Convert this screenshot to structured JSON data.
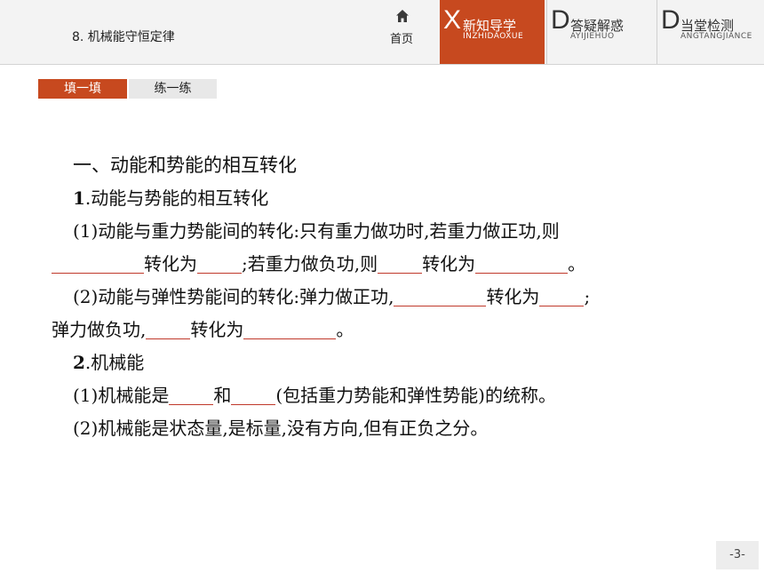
{
  "header": {
    "chapter_title": "8. 机械能守恒定律",
    "home_label": "首页",
    "nav": [
      {
        "letter": "X",
        "label": "新知导学",
        "sub": "INZHIDAOXUE",
        "active": true
      },
      {
        "letter": "D",
        "label": "答疑解惑",
        "sub": "AYIJIEHUO",
        "active": false
      },
      {
        "letter": "D",
        "label": "当堂检测",
        "sub": "ANGTANGJIANCE",
        "active": false
      }
    ]
  },
  "subtabs": [
    "填一填",
    "练一练"
  ],
  "content": {
    "heading": "一、动能和势能的相互转化",
    "s1_num": "1",
    "s1_title": ".动能与势能的相互转化",
    "p1_a": "(1)动能与重力势能间的转化:只有重力做功时,若重力做正功,则",
    "p1_b": "转化为",
    "p1_c": ";若重力做负功,则",
    "p1_d": "转化为",
    "p1_e": "。",
    "p2_a": "(2)动能与弹性势能间的转化:弹力做正功,",
    "p2_b": "转化为",
    "p2_c": ";",
    "p3_a": "弹力做负功,",
    "p3_b": "转化为",
    "p3_c": "。",
    "s2_num": "2",
    "s2_title": ".机械能",
    "p4_a": "(1)机械能是",
    "p4_b": "和",
    "p4_c": "(包括重力势能和弹性势能)的统称。",
    "p5": "(2)机械能是状态量,是标量,没有方向,但有正负之分。"
  },
  "page_number": "-3-",
  "colors": {
    "accent": "#c7491f",
    "blank_line": "#c0392b"
  }
}
